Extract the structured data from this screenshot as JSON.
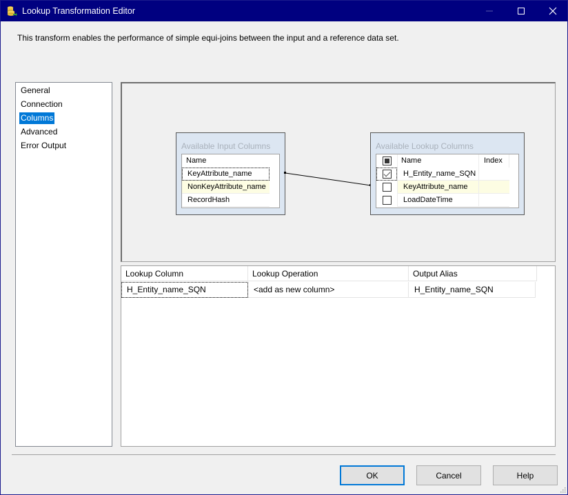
{
  "window": {
    "title": "Lookup Transformation Editor",
    "icon": "database-transform-icon",
    "controls": {
      "minimize": "minimize-icon",
      "maximize": "maximize-icon",
      "close": "close-icon"
    }
  },
  "description": "This transform enables the performance of simple equi-joins between the input and a reference data set.",
  "nav": {
    "items": [
      {
        "label": "General",
        "selected": false
      },
      {
        "label": "Connection",
        "selected": false
      },
      {
        "label": "Columns",
        "selected": true
      },
      {
        "label": "Advanced",
        "selected": false
      },
      {
        "label": "Error Output",
        "selected": false
      }
    ]
  },
  "input_columns": {
    "caption": "Available Input Columns",
    "header": "Name",
    "rows": [
      {
        "name": "KeyAttribute_name",
        "focused": true,
        "highlighted": false
      },
      {
        "name": "NonKeyAttribute_name",
        "focused": false,
        "highlighted": true
      },
      {
        "name": "RecordHash",
        "focused": false,
        "highlighted": false
      }
    ]
  },
  "lookup_columns": {
    "caption": "Available Lookup Columns",
    "header_name": "Name",
    "header_index": "Index",
    "select_all_state": "indeterminate",
    "rows": [
      {
        "name": "H_Entity_name_SQN",
        "checked": true,
        "index": "",
        "highlighted": false,
        "focused": true
      },
      {
        "name": "KeyAttribute_name",
        "checked": false,
        "index": "",
        "highlighted": true,
        "focused": false
      },
      {
        "name": "LoadDateTime",
        "checked": false,
        "index": "",
        "highlighted": false,
        "focused": false
      }
    ]
  },
  "mapping": {
    "from": "KeyAttribute_name",
    "to": "KeyAttribute_name"
  },
  "grid": {
    "headers": [
      "Lookup Column",
      "Lookup Operation",
      "Output Alias"
    ],
    "rows": [
      [
        "H_Entity_name_SQN",
        "<add as new column>",
        "H_Entity_name_SQN"
      ]
    ]
  },
  "buttons": {
    "ok": "OK",
    "cancel": "Cancel",
    "help": "Help"
  },
  "colors": {
    "titlebar": "#000080",
    "selection": "#0078d7",
    "highlight_row": "#fdfde3",
    "box_bg": "#dce6f2"
  }
}
